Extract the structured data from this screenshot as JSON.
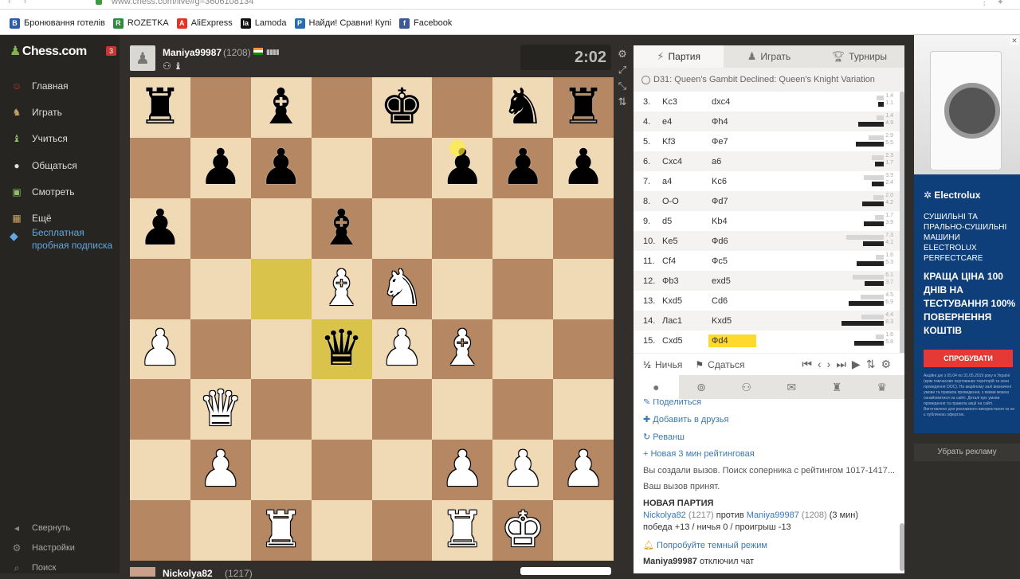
{
  "browser": {
    "url": "www.chess.com/live#g=3606108134",
    "bookmarks": [
      {
        "label": "Бронювання готелів",
        "color": "#2a5caa",
        "glyph": "B"
      },
      {
        "label": "ROZETKA",
        "color": "#2e8b3c",
        "glyph": "R"
      },
      {
        "label": "AliExpress",
        "color": "#e43225",
        "glyph": "A"
      },
      {
        "label": "Lamoda",
        "color": "#111111",
        "glyph": "la"
      },
      {
        "label": "Найди! Сравни! Купі",
        "color": "#2a6cb0",
        "glyph": "P"
      },
      {
        "label": "Facebook",
        "color": "#3b5998",
        "glyph": "f"
      }
    ]
  },
  "sidebar": {
    "logo": "Chess.com",
    "notification_count": "3",
    "items": [
      {
        "label": "Главная",
        "icon": "avatar-icon"
      },
      {
        "label": "Играть",
        "icon": "knight-play-icon"
      },
      {
        "label": "Учиться",
        "icon": "learn-icon"
      },
      {
        "label": "Общаться",
        "icon": "chat-bubble-icon"
      },
      {
        "label": "Смотреть",
        "icon": "watch-icon"
      },
      {
        "label": "Ещё",
        "icon": "more-grid-icon"
      }
    ],
    "trial": "Бесплатная пробная подписка",
    "footer": [
      {
        "label": "Свернуть",
        "icon": "collapse-icon"
      },
      {
        "label": "Настройки",
        "icon": "gear-icon"
      },
      {
        "label": "Поиск",
        "icon": "search-icon"
      }
    ]
  },
  "top_player": {
    "name": "Maniya99987",
    "rating": "(1208)",
    "clock": "2:02"
  },
  "bottom_player": {
    "name": "Nickolya82",
    "rating": "(1217)"
  },
  "board": {
    "ranks": [
      [
        "bR",
        "",
        "bB",
        "",
        "bK",
        "",
        "bN",
        "bR"
      ],
      [
        "",
        "bP",
        "bP",
        "",
        "",
        "bP",
        "bP",
        "bP"
      ],
      [
        "bP",
        "",
        "",
        "bB",
        "",
        "",
        "",
        ""
      ],
      [
        "",
        "",
        "",
        "wB",
        "wN",
        "",
        "",
        ""
      ],
      [
        "wP",
        "",
        "",
        "bQ",
        "wP",
        "wB",
        "",
        ""
      ],
      [
        "",
        "wQ",
        "",
        "",
        "",
        "",
        "",
        ""
      ],
      [
        "",
        "wP",
        "",
        "",
        "",
        "wP",
        "wP",
        "wP"
      ],
      [
        "",
        "",
        "wR",
        "",
        "",
        "wR",
        "wK",
        ""
      ]
    ],
    "highlighted": [
      "c5",
      "d4"
    ]
  },
  "panel": {
    "tabs": [
      {
        "label": "Партия",
        "icon": "lightning-icon"
      },
      {
        "label": "Играть",
        "icon": "pawn-icon"
      },
      {
        "label": "Турниры",
        "icon": "trophy-icon"
      }
    ],
    "opening": "D31: Queen's Gambit Declined: Queen's Knight Variation",
    "moves": [
      {
        "no": "3.",
        "white": "Kc3",
        "black": "dxc4",
        "t1": "1.4",
        "t2": "1.1",
        "v1": 1.4,
        "v2": 1.1
      },
      {
        "no": "4.",
        "white": "e4",
        "black": "Фh4",
        "t1": "1.4",
        "t2": "4.9",
        "v1": 1.4,
        "v2": 4.9
      },
      {
        "no": "5.",
        "white": "Kf3",
        "black": "Фe7",
        "t1": "2.9",
        "t2": "5.5",
        "v1": 2.9,
        "v2": 5.5
      },
      {
        "no": "6.",
        "white": "Cxc4",
        "black": "a6",
        "t1": "2.3",
        "t2": "1.7",
        "v1": 2.3,
        "v2": 1.7
      },
      {
        "no": "7.",
        "white": "a4",
        "black": "Kc6",
        "t1": "3.9",
        "t2": "2.4",
        "v1": 3.9,
        "v2": 2.4
      },
      {
        "no": "8.",
        "white": "O-O",
        "black": "Фd7",
        "t1": "2.0",
        "t2": "4.2",
        "v1": 2.0,
        "v2": 4.2
      },
      {
        "no": "9.",
        "white": "d5",
        "black": "Kb4",
        "t1": "1.7",
        "t2": "3.9",
        "v1": 1.7,
        "v2": 3.9
      },
      {
        "no": "10.",
        "white": "Ke5",
        "black": "Фd6",
        "t1": "7.3",
        "t2": "4.1",
        "v1": 7.3,
        "v2": 4.1
      },
      {
        "no": "11.",
        "white": "Cf4",
        "black": "Фc5",
        "t1": "1.6",
        "t2": "5.3",
        "v1": 1.6,
        "v2": 5.3
      },
      {
        "no": "12.",
        "white": "Фb3",
        "black": "exd5",
        "t1": "6.1",
        "t2": "3.7",
        "v1": 6.1,
        "v2": 3.7
      },
      {
        "no": "13.",
        "white": "Kxd5",
        "black": "Cd6",
        "t1": "4.5",
        "t2": "6.9",
        "v1": 4.5,
        "v2": 6.9
      },
      {
        "no": "14.",
        "white": "Лac1",
        "black": "Kxd5",
        "t1": "4.4",
        "t2": "8.3",
        "v1": 4.4,
        "v2": 8.3
      },
      {
        "no": "15.",
        "white": "Cxd5",
        "black": "Фd4",
        "t1": "1.6",
        "t2": "5.8",
        "v1": 1.6,
        "v2": 5.8
      }
    ],
    "draw_label": "Ничья",
    "resign_label": "Сдаться"
  },
  "chat": {
    "share": "Поделиться",
    "add_friend": "Добавить в друзья",
    "rematch": "Реванш",
    "new_game_link": "Новая 3 мин рейтинговая",
    "msg_challenge": "Вы создали вызов. Поиск соперника с рейтингом 1017-1417...",
    "msg_accepted": "Ваш вызов принят.",
    "new_game_header": "НОВАЯ ПАРТИЯ",
    "p1": "Nickolya82",
    "p1_rating": "(1217)",
    "versus": "против",
    "p2": "Maniya99987",
    "p2_rating": "(1208)",
    "time_control": "(3 мин)",
    "stakes": "победа +13 / ничья 0 / проигрыш -13",
    "dark_mode": "Попробуйте темный режим",
    "left_user": "Maniya99987",
    "left_text": "отключил чат"
  },
  "ad": {
    "brand": "Electrolux",
    "line1": "СУШИЛЬНІ ТА ПРАЛЬНО-СУШИЛЬНІ МАШИНИ ELECTROLUX PERFECTCARE",
    "line2": "КРАЩА ЦІНА 100 ДНІВ НА ТЕСТУВАННЯ 100% ПОВЕРНЕННЯ КОШТІВ",
    "cta": "СПРОБУВАТИ",
    "fine": "Акційні дні з 05.04 по 31.05.2019 року в Україні (крім тимчасово окупованих територій та зони проведення ООС). На акційному залі визначені умови та правила проведення, з якими можна ознайомитися на сайті. Деталі про умови проведення та правила акції на сайті. Виготовлено для рекламного використання та не є публічною офертою.",
    "remove": "Убрать рекламу"
  }
}
